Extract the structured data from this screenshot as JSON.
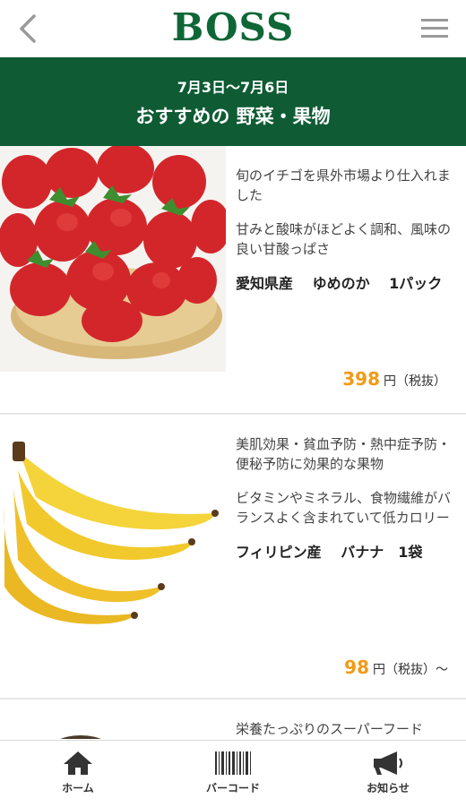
{
  "header": {
    "brand": "BOSS",
    "back_icon": "chevron-left-icon",
    "menu_icon": "hamburger-menu-icon"
  },
  "banner": {
    "dates": "7月3日〜7月6日",
    "title": "おすすめの 野菜・果物",
    "color": "#0e5b34"
  },
  "products": [
    {
      "desc1": "旬のイチゴを県外市場より仕入れました",
      "desc2": "甘みと酸味がほどよく調和、風味の良い甘酸っぱさ",
      "name": "愛知県産　 ゆめのか　 1パック",
      "price": "398",
      "unit": "円（税抜）"
    },
    {
      "desc1": "美肌効果・貧血予防・熱中症予防・便秘予防に効果的な果物",
      "desc2": "ビタミンやミネラル、食物繊維がバランスよく含まれていて低カロリー",
      "name": "フィリピン産　 バナナ　1袋",
      "price": "98",
      "unit": "円（税抜）〜"
    },
    {
      "desc1": "栄養たっぷりのスーパーフード"
    }
  ],
  "tabbar": {
    "home": "ホーム",
    "barcode": "バーコード",
    "news": "お知らせ"
  },
  "colors": {
    "brand": "#0f6637",
    "price": "#f29a16"
  }
}
